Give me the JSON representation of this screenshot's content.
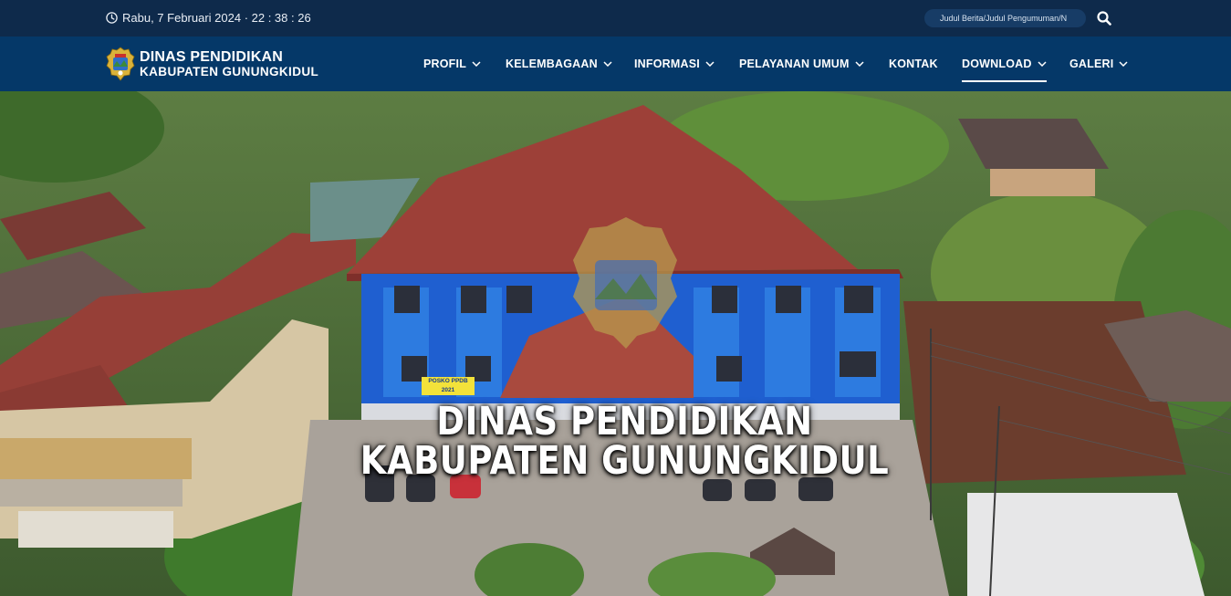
{
  "topbar": {
    "datetime": "Rabu, 7 Februari 2024 · 22 : 38 : 26",
    "search_placeholder": "Judul Berita/Judul Pengumuman/N",
    "clock_icon": "clock-icon",
    "search_icon": "search-icon"
  },
  "brand": {
    "line1": "DINAS PENDIDIKAN",
    "line2": "KABUPATEN GUNUNGKIDUL",
    "logo_icon": "gunungkidul-crest-logo"
  },
  "nav": {
    "profil": "PROFIL",
    "kelembagaan": "KELEMBAGAAN",
    "informasi": "INFORMASI",
    "pelayanan": "PELAYANAN UMUM",
    "kontak": "KONTAK",
    "download": "DOWNLOAD",
    "galeri": "GALERI",
    "active": "DOWNLOAD"
  },
  "hero": {
    "title_line1": "DINAS PENDIDIKAN",
    "title_line2": "KABUPATEN GUNUNGKIDUL",
    "banner_text": "POSKO PPDB 2021"
  },
  "colors": {
    "topbar_bg": "#0e2a4b",
    "navbar_bg": "#053868",
    "building_blue": "#1f5fd0",
    "roof_red": "#a2403a"
  }
}
